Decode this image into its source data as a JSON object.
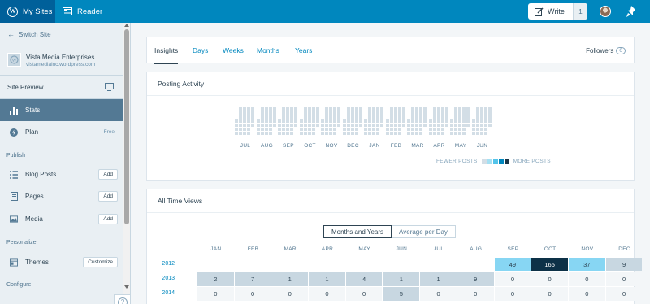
{
  "masterbar": {
    "my_sites": "My Sites",
    "reader": "Reader",
    "write": "Write",
    "write_count": "1"
  },
  "sidebar": {
    "switch_site": "Switch Site",
    "site_name": "Vista Media Enterprises",
    "site_domain": "vistamediainc.wordpress.com",
    "site_preview": "Site Preview",
    "stats": "Stats",
    "plan": "Plan",
    "plan_badge": "Free",
    "publish_heading": "Publish",
    "blog_posts": "Blog Posts",
    "pages": "Pages",
    "media": "Media",
    "add_label": "Add",
    "personalize_heading": "Personalize",
    "themes": "Themes",
    "customize": "Customize",
    "configure_heading": "Configure",
    "help": "?"
  },
  "tabs": {
    "items": [
      "Insights",
      "Days",
      "Weeks",
      "Months",
      "Years"
    ],
    "selected": "Insights",
    "followers_label": "Followers",
    "followers_count": "0"
  },
  "posting_activity": {
    "title": "Posting Activity",
    "months": [
      "JUL",
      "AUG",
      "SEP",
      "OCT",
      "NOV",
      "DEC",
      "JAN",
      "FEB",
      "MAR",
      "APR",
      "MAY",
      "JUN"
    ],
    "legend_fewer": "FEWER POSTS",
    "legend_more": "MORE POSTS",
    "colors": {
      "empty": "#d3dee6",
      "scale": [
        "#d3dee6",
        "#a4e0f3",
        "#53c4ea",
        "#0087be",
        "#1b3546"
      ]
    }
  },
  "all_time_views": {
    "title": "All Time Views",
    "toggle": [
      "Months and Years",
      "Average per Day"
    ],
    "selected_toggle": "Months and Years",
    "months": [
      "JAN",
      "FEB",
      "MAR",
      "APR",
      "MAY",
      "JUN",
      "JUL",
      "AUG",
      "SEP",
      "OCT",
      "NOV",
      "DEC"
    ],
    "rows": [
      {
        "year": "2012",
        "values": [
          "",
          "",
          "",
          "",
          "",
          "",
          "",
          "",
          "49",
          "165",
          "37",
          "9"
        ]
      },
      {
        "year": "2013",
        "values": [
          "2",
          "7",
          "1",
          "1",
          "4",
          "1",
          "1",
          "9",
          "0",
          "0",
          "0",
          "0"
        ]
      },
      {
        "year": "2014",
        "values": [
          "0",
          "0",
          "0",
          "0",
          "0",
          "5",
          "0",
          "0",
          "0",
          "0",
          "0",
          "0"
        ]
      }
    ],
    "colors": {
      "nodata": "#ffffff",
      "zero": "#f3f6f8",
      "low": "#c8d7e1",
      "mid": "#cfeff9",
      "high": "#87d6f3",
      "peak": "#0d3147"
    }
  }
}
